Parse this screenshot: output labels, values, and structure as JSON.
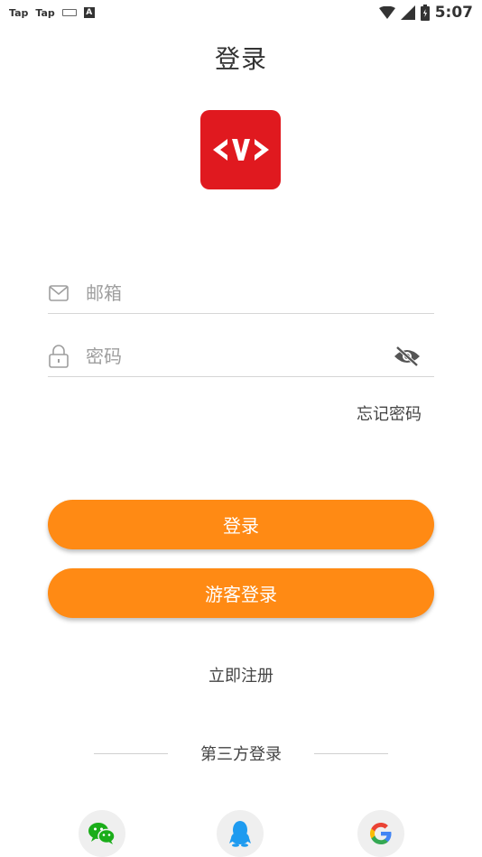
{
  "status_bar": {
    "app1": "Tap",
    "app2": "Tap",
    "keyboard_letter": "A",
    "time": "5:07"
  },
  "header": {
    "title": "登录"
  },
  "form": {
    "email": {
      "placeholder": "邮箱",
      "value": ""
    },
    "password": {
      "placeholder": "密码",
      "value": ""
    },
    "forgot_label": "忘记密码"
  },
  "buttons": {
    "login_label": "登录",
    "guest_label": "游客登录"
  },
  "register_label": "立即注册",
  "third_party": {
    "label": "第三方登录",
    "providers": [
      "wechat-icon",
      "qq-icon",
      "google-icon"
    ]
  },
  "colors": {
    "accent": "#ff8a14",
    "logo_bg": "#e0191f",
    "wechat": "#1aad19",
    "qq": "#1e9bf0"
  }
}
